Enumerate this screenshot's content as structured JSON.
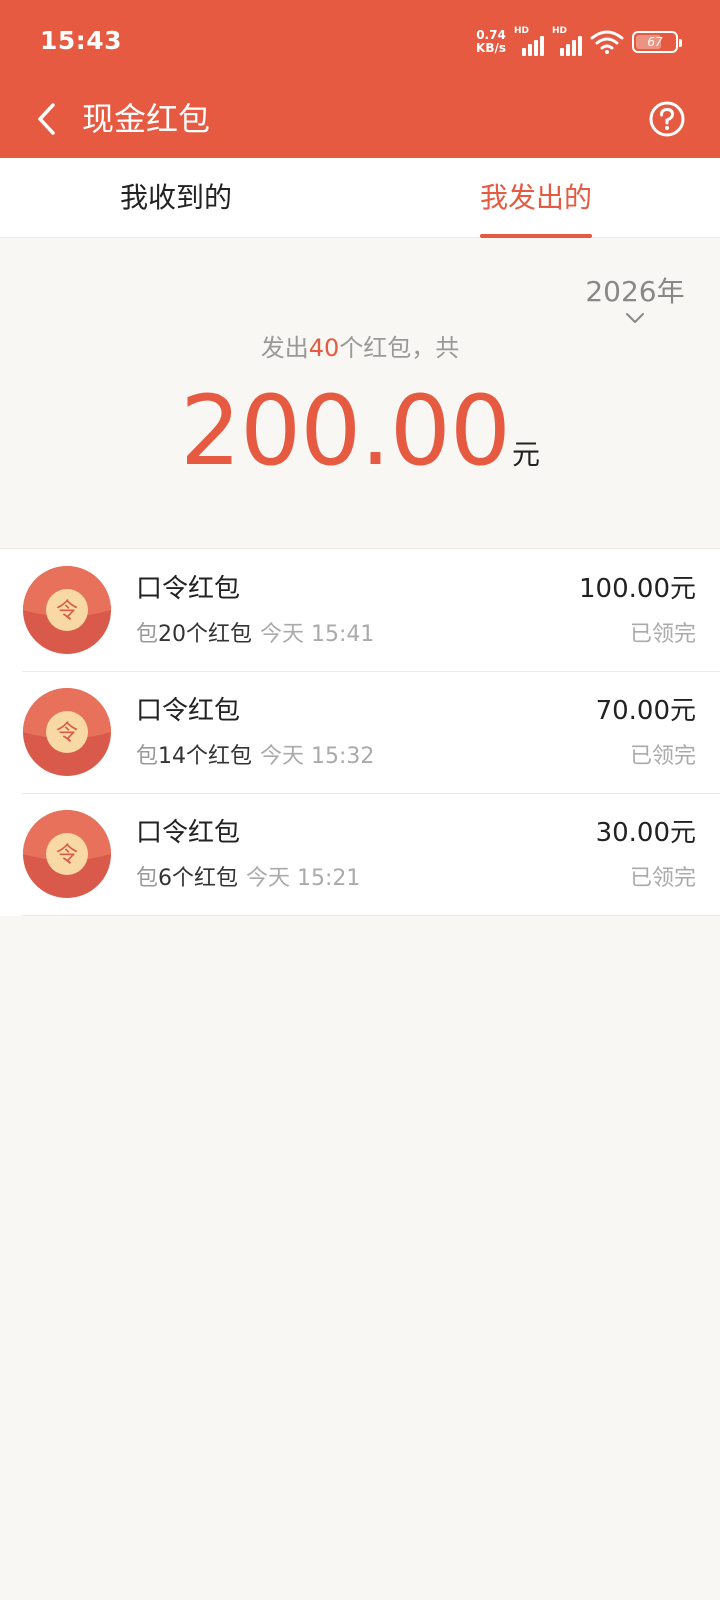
{
  "status_bar": {
    "time": "15:43",
    "net_speed_value": "0.74",
    "net_speed_unit": "KB/s",
    "sim1_label": "HD",
    "sim2_label": "HD",
    "battery_level": "67"
  },
  "nav": {
    "title": "现金红包",
    "icons": {
      "back": "chevron-left-icon",
      "help": "question-circle-icon"
    }
  },
  "tabs": [
    {
      "label": "我收到的",
      "active": false
    },
    {
      "label": "我发出的",
      "active": true
    }
  ],
  "summary": {
    "year": "2026年",
    "prefix": "发出",
    "count": "40",
    "suffix": "个红包，共",
    "total": "200.00",
    "unit": "元"
  },
  "packets": [
    {
      "type": "口令红包",
      "prefix": "包",
      "count_text": "20个红包",
      "time": "今天 15:41",
      "amount": "100.00元",
      "status": "已领完"
    },
    {
      "type": "口令红包",
      "prefix": "包",
      "count_text": "14个红包",
      "time": "今天 15:32",
      "amount": "70.00元",
      "status": "已领完"
    },
    {
      "type": "口令红包",
      "prefix": "包",
      "count_text": "6个红包",
      "time": "今天 15:21",
      "amount": "30.00元",
      "status": "已领完"
    }
  ],
  "packet_icon": {
    "glyph": "令",
    "name": "red-packet-icon"
  },
  "colors": {
    "accent": "#e55a40",
    "background": "#f8f7f3",
    "packet_red": "#e2604c",
    "packet_coin": "#f8d9a5"
  }
}
